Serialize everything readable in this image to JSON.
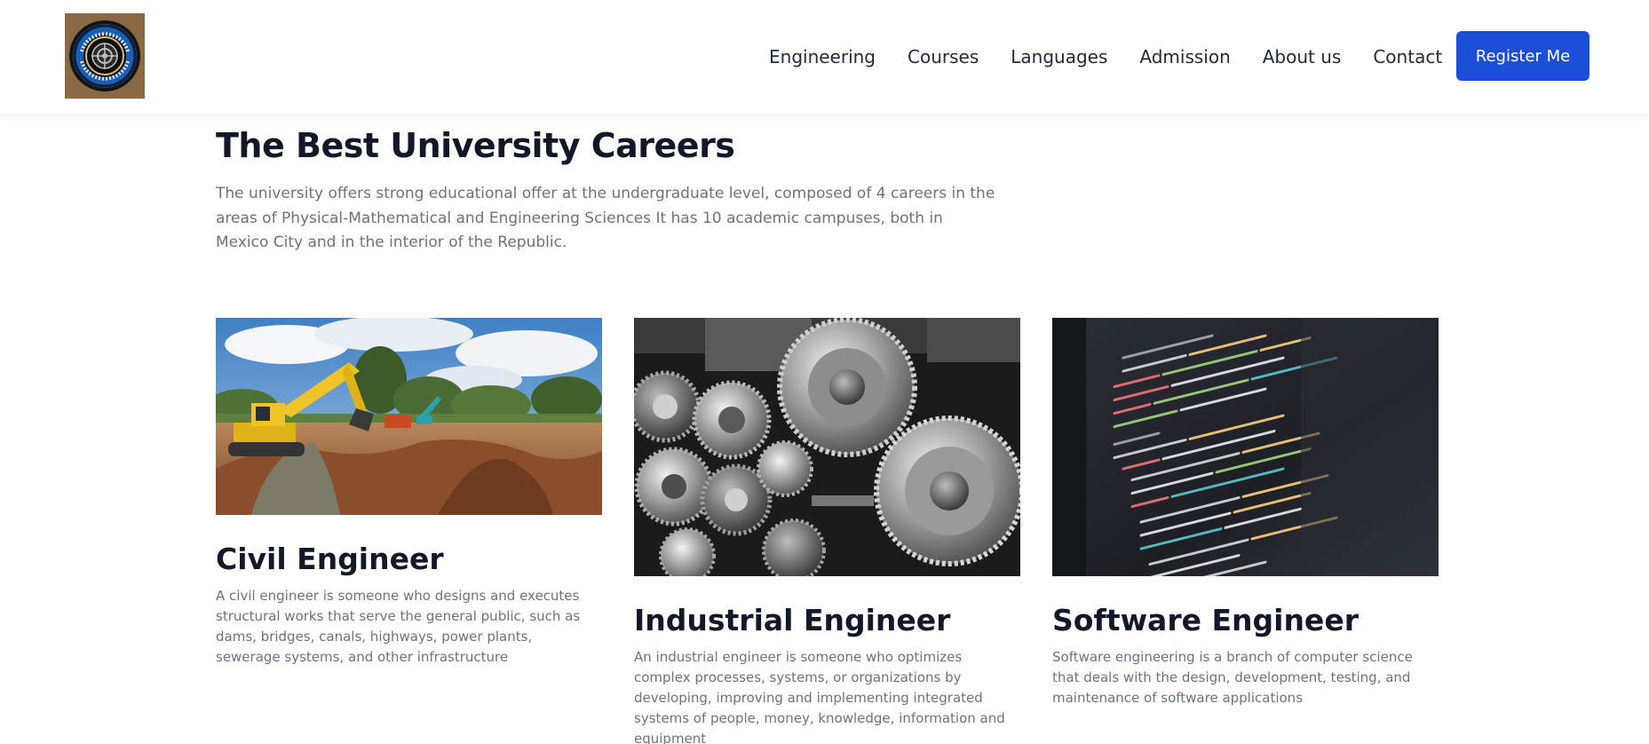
{
  "nav": {
    "logo_alt": "University seal",
    "links": [
      "Engineering",
      "Courses",
      "Languages",
      "Admission",
      "About us",
      "Contact"
    ],
    "register_label": "Register Me"
  },
  "hero": {
    "title": "The Best University Careers",
    "description": "The university offers strong educational offer at the undergraduate level, composed of 4 careers in the areas of Physical-Mathematical and Engineering Sciences It has 10 academic campuses, both in Mexico City and in the interior of the Republic."
  },
  "cards": [
    {
      "title": "Civil Engineer",
      "text": "A civil engineer is someone who designs and executes structural works that serve the general public, such as dams, bridges, canals, highways, power plants, sewerage systems, and other infrastructure",
      "image": "construction-excavator-photo"
    },
    {
      "title": "Industrial Engineer",
      "text": "An industrial engineer is someone who optimizes complex processes, systems, or organizations by developing, improving and implementing integrated systems of people, money, knowledge, information and equipment",
      "image": "machine-gears-photo"
    },
    {
      "title": "Software Engineer",
      "text": "Software engineering is a branch of computer science that deals with the design, development, testing, and maintenance of software applications",
      "image": "code-on-screen-photo"
    }
  ],
  "colors": {
    "primary": "#1d4ed8",
    "heading": "#111827",
    "body_text": "#6b7280"
  }
}
